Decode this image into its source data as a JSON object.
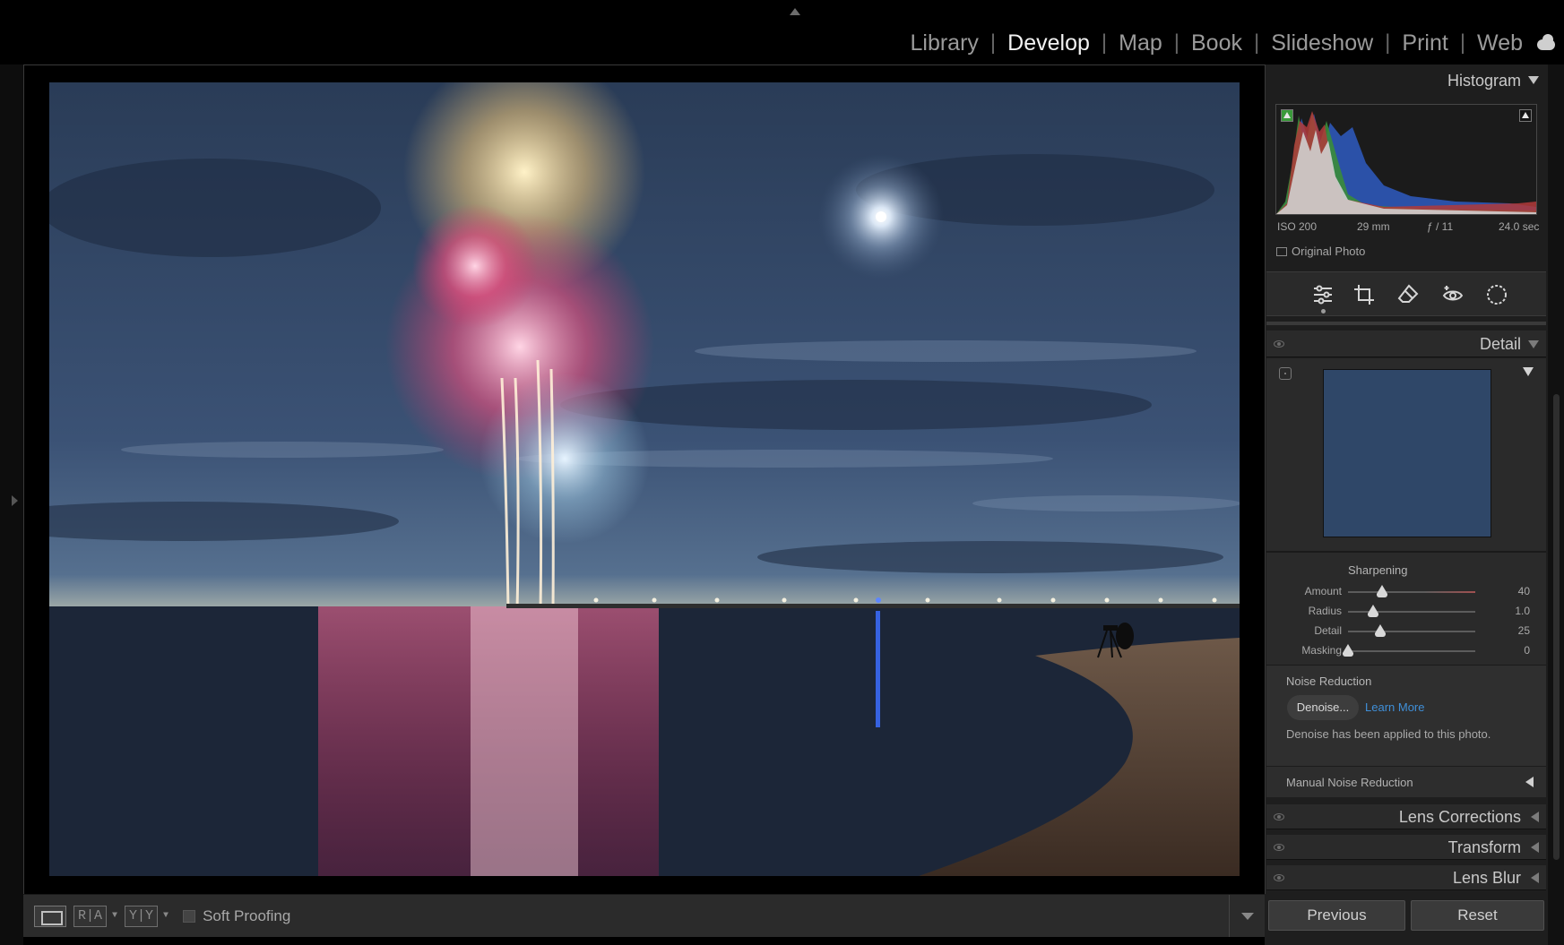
{
  "modules": [
    "Library",
    "Develop",
    "Map",
    "Book",
    "Slideshow",
    "Print",
    "Web"
  ],
  "active_module": "Develop",
  "histogram": {
    "title": "Histogram",
    "iso": "ISO 200",
    "focal_length": "29 mm",
    "aperture": "ƒ / 11",
    "shutter": "24.0 sec",
    "original_photo_label": "Original Photo"
  },
  "tools": [
    "edit-sliders-icon",
    "crop-icon",
    "heal-eraser-icon",
    "redeye-icon",
    "masking-icon"
  ],
  "detail": {
    "title": "Detail",
    "sharpening": {
      "title": "Sharpening",
      "sliders": [
        {
          "label": "Amount",
          "value": 40,
          "display": "40",
          "min": 0,
          "max": 150
        },
        {
          "label": "Radius",
          "value": 1.0,
          "display": "1.0",
          "min": 0.5,
          "max": 3.0
        },
        {
          "label": "Detail",
          "value": 25,
          "display": "25",
          "min": 0,
          "max": 100
        },
        {
          "label": "Masking",
          "value": 0,
          "display": "0",
          "min": 0,
          "max": 100
        }
      ]
    },
    "noise_reduction": {
      "title": "Noise Reduction",
      "denoise_label": "Denoise...",
      "learn_more": "Learn More",
      "applied_text": "Denoise has been applied to this photo.",
      "manual_label": "Manual Noise Reduction"
    }
  },
  "panels": {
    "lens_corrections": "Lens Corrections",
    "transform": "Transform",
    "lens_blur": "Lens Blur"
  },
  "toolbar": {
    "ra_label": "R|A",
    "yy_label": "Y|Y",
    "soft_proofing": "Soft Proofing"
  },
  "buttons": {
    "previous": "Previous",
    "reset": "Reset"
  },
  "colors": {
    "panel_bg": "#2a2a2a",
    "accent_link": "#3f8fd8",
    "preview_blue": "#2f4768"
  }
}
